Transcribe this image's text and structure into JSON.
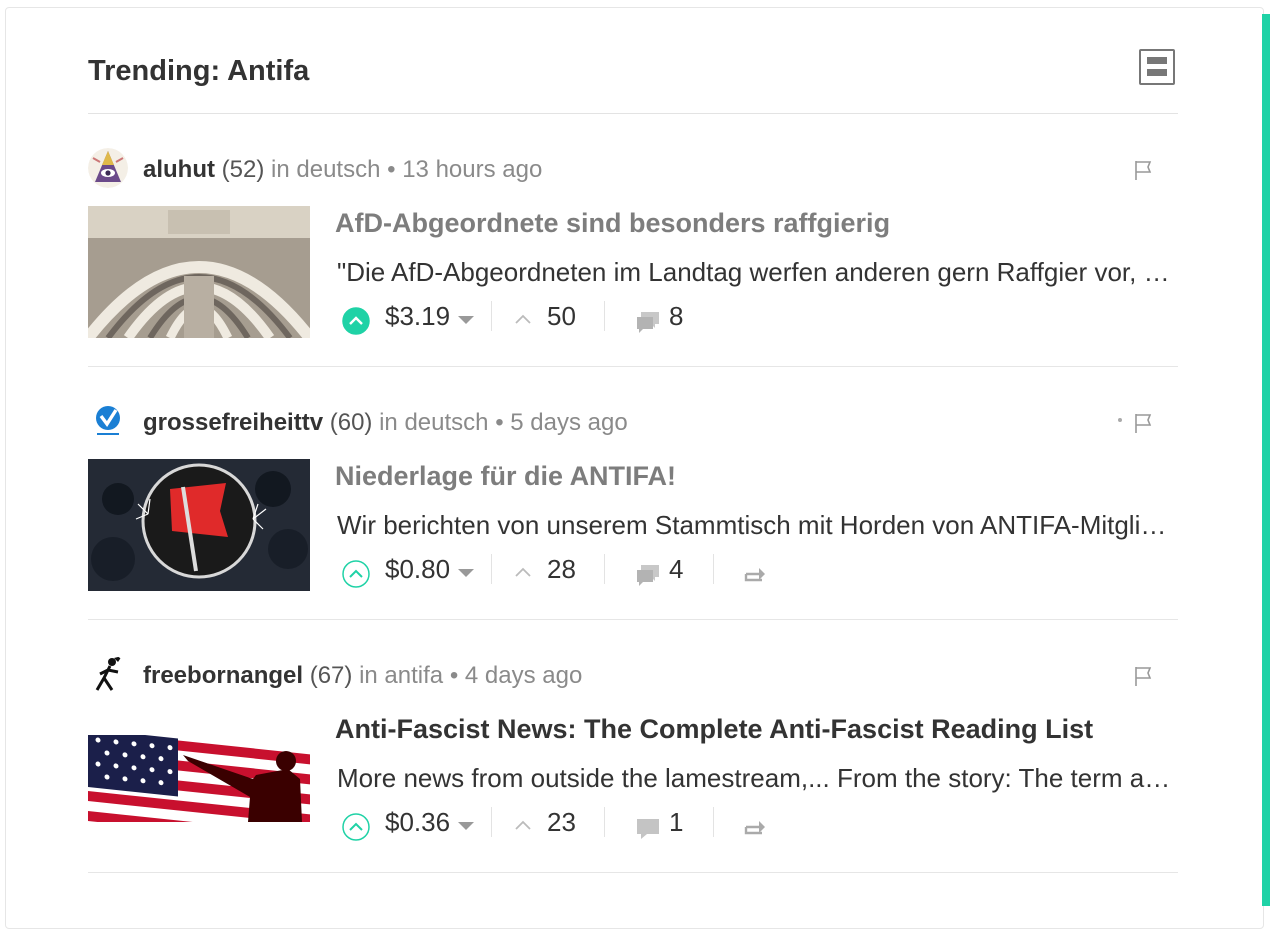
{
  "colors": {
    "accent": "#1fd2a6",
    "vote_active": "#1fd2a6",
    "muted": "#999999"
  },
  "header": {
    "title": "Trending: Antifa",
    "layout_toggle_icon": "list-layout-icon"
  },
  "posts": [
    {
      "author": "aluhut",
      "reputation": "(52)",
      "in_label": "in",
      "category": "deutsch",
      "separator": "•",
      "time": "13 hours ago",
      "title": "AfD-Abgeordnete sind besonders raffgierig",
      "excerpt": "\"Die AfD-Abgeordneten im Landtag werfen anderen gern Raffgier vor, doch wenn es um die eigenen Bezüge geht",
      "payout": "$3.19",
      "votes": "50",
      "comments": "8",
      "upvoted": true,
      "reblog": false
    },
    {
      "author": "grossefreiheittv",
      "reputation": "(60)",
      "in_label": "in",
      "category": "deutsch",
      "separator": "•",
      "time": "5 days ago",
      "title": "Niederlage für die ANTIFA!",
      "excerpt": "Wir berichten von unserem Stammtisch mit Horden von ANTIFA-Mitgliedern vor der Tür",
      "payout": "$0.80",
      "votes": "28",
      "comments": "4",
      "upvoted": false,
      "reblog": true
    },
    {
      "author": "freebornangel",
      "reputation": "(67)",
      "in_label": "in",
      "category": "antifa",
      "separator": "•",
      "time": "4 days ago",
      "title": "Anti-Fascist News: The Complete Anti-Fascist Reading List",
      "excerpt": "More news from outside the lamestream,... From the story: The term antifascism is thrown around a lot",
      "payout": "$0.36",
      "votes": "23",
      "comments": "1",
      "upvoted": false,
      "reblog": true
    }
  ]
}
